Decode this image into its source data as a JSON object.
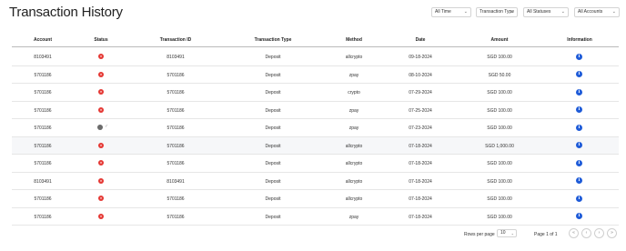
{
  "header": {
    "title": "Transaction History"
  },
  "filters": [
    {
      "label": "All Time"
    },
    {
      "label": "Transaction Type"
    },
    {
      "label": "All Statuses"
    },
    {
      "label": "All Accounts"
    }
  ],
  "table": {
    "columns": [
      "Account",
      "Status",
      "Transaction ID",
      "Transaction Type",
      "Method",
      "Date",
      "Amount",
      "Information"
    ],
    "rows": [
      {
        "account": "8103491",
        "status": "failed",
        "tx_id": "8103491",
        "type": "Deposit",
        "method": "allcrypto",
        "date": "09-18-2024",
        "amount": "SGD 100.00"
      },
      {
        "account": "5701186",
        "status": "failed",
        "tx_id": "5701186",
        "type": "Deposit",
        "method": "zpay",
        "date": "08-10-2024",
        "amount": "SGD 50.00"
      },
      {
        "account": "5701186",
        "status": "failed",
        "tx_id": "5701186",
        "type": "Deposit",
        "method": "crypto",
        "date": "07-29-2024",
        "amount": "SGD 100.00"
      },
      {
        "account": "5701186",
        "status": "failed",
        "tx_id": "5701186",
        "type": "Deposit",
        "method": "zpay",
        "date": "07-25-2024",
        "amount": "SGD 100.00"
      },
      {
        "account": "5701186",
        "status": "pending",
        "tx_id": "5701186",
        "type": "Deposit",
        "method": "zpay",
        "date": "07-23-2024",
        "amount": "SGD 100.00"
      },
      {
        "account": "5701186",
        "status": "failed",
        "tx_id": "5701186",
        "type": "Deposit",
        "method": "allcrypto",
        "date": "07-18-2024",
        "amount": "SGD 1,000.00"
      },
      {
        "account": "5701186",
        "status": "failed",
        "tx_id": "5701186",
        "type": "Deposit",
        "method": "allcrypto",
        "date": "07-18-2024",
        "amount": "SGD 100.00"
      },
      {
        "account": "8103491",
        "status": "failed",
        "tx_id": "8103491",
        "type": "Deposit",
        "method": "allcrypto",
        "date": "07-18-2024",
        "amount": "SGD 100.00"
      },
      {
        "account": "5701186",
        "status": "failed",
        "tx_id": "5701186",
        "type": "Deposit",
        "method": "allcrypto",
        "date": "07-18-2024",
        "amount": "SGD 100.00"
      },
      {
        "account": "5701186",
        "status": "failed",
        "tx_id": "5701186",
        "type": "Deposit",
        "method": "zpay",
        "date": "07-18-2024",
        "amount": "SGD 100.00"
      }
    ]
  },
  "footer": {
    "rows_per_page_label": "Rows per page",
    "rows_per_page_value": "10",
    "page_info": "Page 1 of 1",
    "nav_buttons": [
      "«",
      "‹",
      "›",
      "»"
    ]
  },
  "colors": {
    "failed": "#e53935",
    "pending": "#6b6b6b",
    "info": "#1e5bd8",
    "highlight_row": "#f6f7f9"
  }
}
